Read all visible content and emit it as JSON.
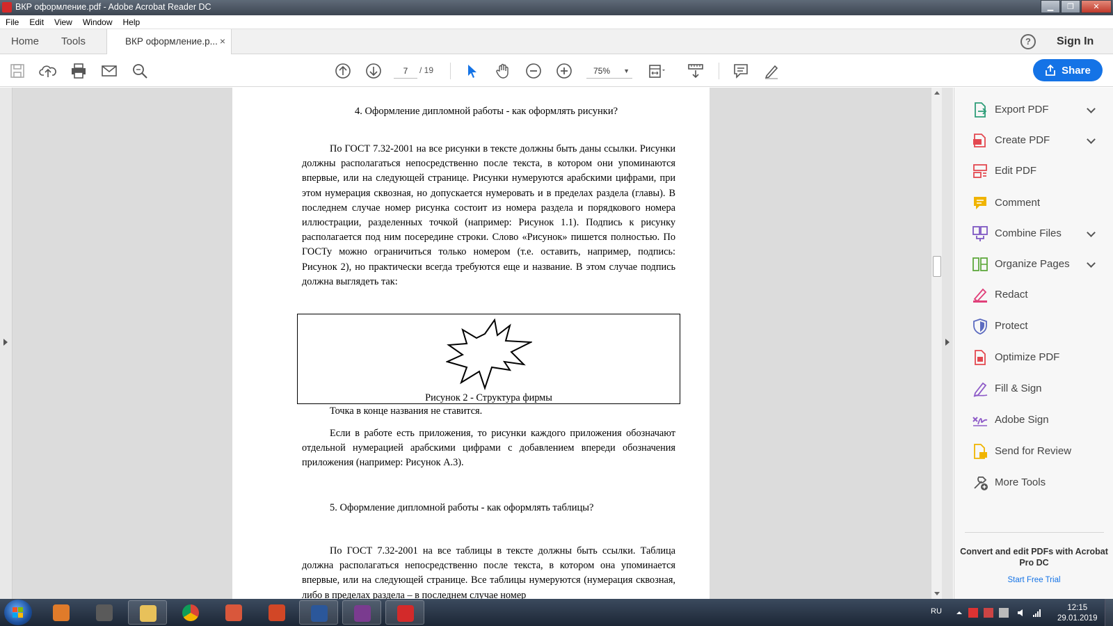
{
  "window": {
    "title": "ВКР оформление.pdf - Adobe Acrobat Reader DC",
    "minimize": "▁",
    "maximize": "❐",
    "close": "✕"
  },
  "menu": [
    "File",
    "Edit",
    "View",
    "Window",
    "Help"
  ],
  "tabs": {
    "home": "Home",
    "tools": "Tools",
    "document": "ВКР оформление.р...",
    "close_glyph": "×",
    "help": "?",
    "sign_in": "Sign In"
  },
  "toolbar": {
    "current_page": "7",
    "total_pages": "/ 19",
    "zoom": "75%",
    "zoom_caret": "▼",
    "share": "Share"
  },
  "document": {
    "heading1": "4.  Оформление дипломной работы - как оформлять рисунки?",
    "para1": "По ГОСТ 7.32-2001 на все рисунки в тексте должны быть даны ссылки. Рисунки должны располагаться непосредственно после текста, в котором они упоминаются впервые, или на следующей странице. Рисунки нумеруются арабскими цифрами, при этом нумерация сквозная, но допускается нумеровать и в пределах раздела (главы). В последнем случае номер рисунка состоит из номера раздела и порядкового номера иллюстрации, разделенных точкой (например: Рисунок 1.1). Подпись к рисунку располагается под ним посередине строки. Слово «Рисунок» пишется полностью. По ГОСТу можно ограничиться только номером (т.е. оставить, например, подпись: Рисунок 2), но практически всегда требуются еще и название. В этом случае подпись должна выглядеть так:",
    "figure_caption": "Рисунок 2 - Структура фирмы",
    "para2": "Точка в конце названия не ставится.",
    "para3": "Если в работе есть приложения, то рисунки каждого приложения обозначают отдельной нумерацией арабскими цифрами с добавлением впереди обозначения приложения (например: Рисунок А.3).",
    "heading2": "5.  Оформление дипломной работы - как оформлять таблицы?",
    "para4": "По ГОСТ 7.32-2001 на все таблицы в тексте должны быть ссылки. Таблица должна располагаться непосредственно после текста, в котором она упоминается впервые, или на следующей странице. Все таблицы нумеруются (нумерация сквозная, либо в пределах раздела – в последнем случае номер"
  },
  "tools_panel": {
    "items": [
      {
        "label": "Export PDF",
        "icon": "export-pdf-icon",
        "color": "#2d9d78",
        "chevron": true
      },
      {
        "label": "Create PDF",
        "icon": "create-pdf-icon",
        "color": "#e34850",
        "chevron": true
      },
      {
        "label": "Edit PDF",
        "icon": "edit-pdf-icon",
        "color": "#e34850",
        "chevron": false
      },
      {
        "label": "Comment",
        "icon": "comment-icon",
        "color": "#f0b400",
        "chevron": false
      },
      {
        "label": "Combine Files",
        "icon": "combine-files-icon",
        "color": "#7e57c2",
        "chevron": true
      },
      {
        "label": "Organize Pages",
        "icon": "organize-pages-icon",
        "color": "#5fa83d",
        "chevron": true
      },
      {
        "label": "Redact",
        "icon": "redact-icon",
        "color": "#e0407a",
        "chevron": false
      },
      {
        "label": "Protect",
        "icon": "protect-icon",
        "color": "#5c6bc0",
        "chevron": false
      },
      {
        "label": "Optimize PDF",
        "icon": "optimize-pdf-icon",
        "color": "#e34850",
        "chevron": false
      },
      {
        "label": "Fill & Sign",
        "icon": "fill-sign-icon",
        "color": "#8e5bc8",
        "chevron": false
      },
      {
        "label": "Adobe Sign",
        "icon": "adobe-sign-icon",
        "color": "#8e5bc8",
        "chevron": false
      },
      {
        "label": "Send for Review",
        "icon": "send-review-icon",
        "color": "#f0b400",
        "chevron": false
      },
      {
        "label": "More Tools",
        "icon": "more-tools-icon",
        "color": "#555555",
        "chevron": false
      }
    ],
    "promo": "Convert and edit PDFs with Acrobat Pro DC",
    "trial": "Start Free Trial"
  },
  "taskbar": {
    "lang": "RU",
    "time": "12:15",
    "date": "29.01.2019"
  },
  "colors": {
    "accent": "#1473e6",
    "viewer_bg": "#dcdcdc"
  }
}
